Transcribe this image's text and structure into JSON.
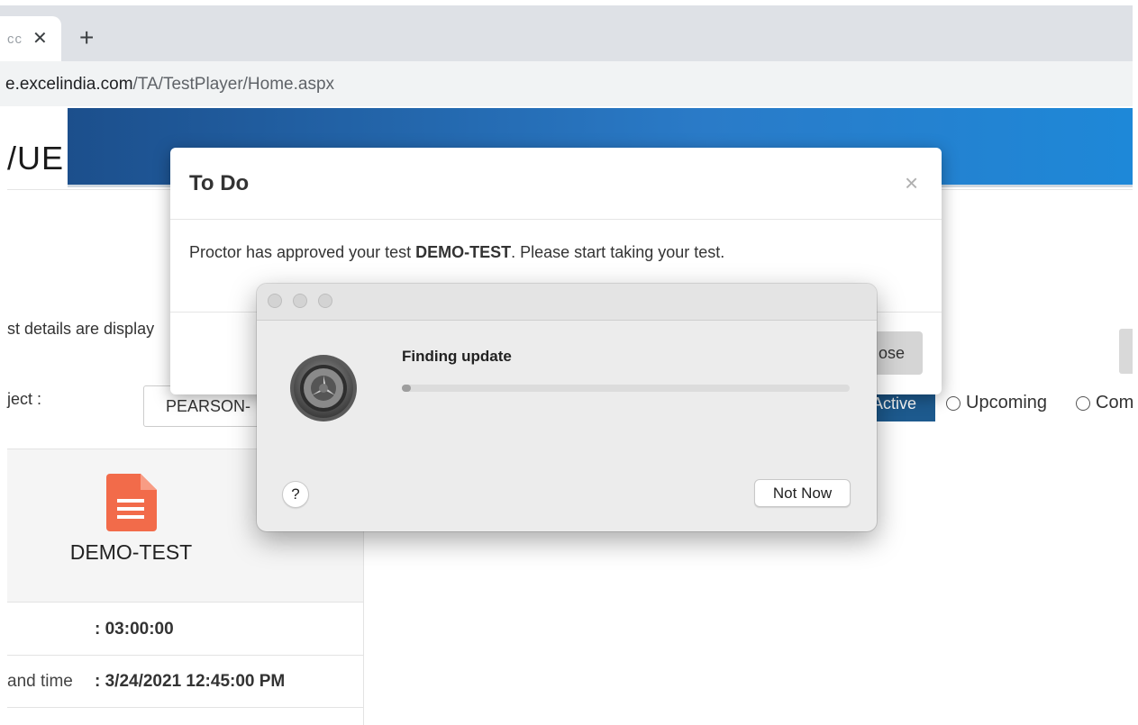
{
  "browser": {
    "tab_title": "cc",
    "tab_close_glyph": "✕",
    "new_tab_glyph": "+",
    "url_host": "e.excelindia.com",
    "url_path": "/TA/TestPlayer/Home.aspx"
  },
  "page": {
    "logo_text": "/UE",
    "details_text": "st details are display",
    "subject_label": "ject :",
    "subject_value": "PEARSON-",
    "filter_active": "Active",
    "filter_upcoming": "Upcoming",
    "filter_completed": "Com",
    "card": {
      "title": "DEMO-TEST",
      "rows": [
        {
          "label": "",
          "value": ": 03:00:00"
        },
        {
          "label": "and time",
          "value": ": 3/24/2021 12:45:00 PM"
        }
      ]
    },
    "colors": {
      "banner_start": "#1c4f8c",
      "banner_end": "#1e88d8",
      "active_pill": "#1d5a8e",
      "doc_icon": "#f26b4a"
    }
  },
  "todo_modal": {
    "title": "To Do",
    "close_glyph": "×",
    "message_prefix": "Proctor has approved your test ",
    "message_test": "DEMO-TEST",
    "message_suffix": ". Please start taking your test.",
    "button_label": "ose"
  },
  "update_dialog": {
    "heading": "Finding update",
    "progress": 0.02,
    "help_label": "?",
    "not_now_label": "Not Now",
    "icon": "system-preferences-gear-icon"
  }
}
